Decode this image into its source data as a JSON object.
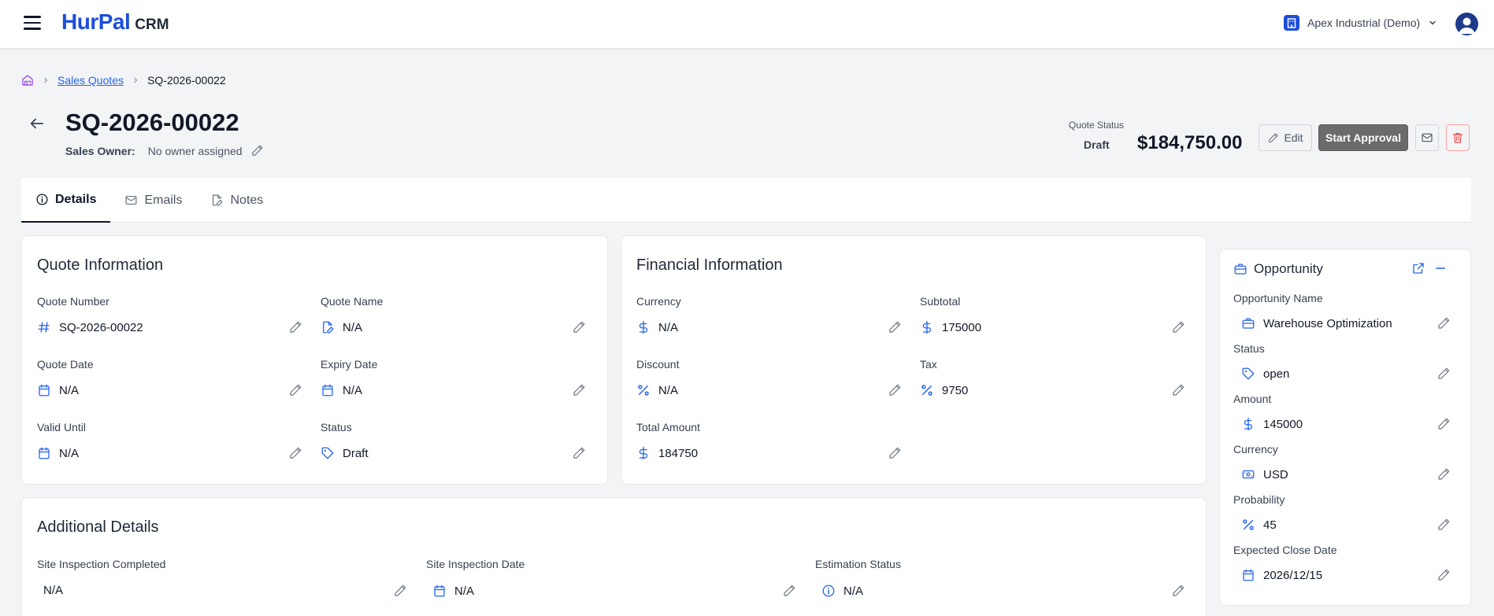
{
  "app": {
    "logo_main": "HurPal",
    "logo_sub": "CRM"
  },
  "org": {
    "name": "Apex Industrial (Demo)"
  },
  "breadcrumb": {
    "parent": "Sales Quotes",
    "current": "SQ-2026-00022"
  },
  "header": {
    "title": "SQ-2026-00022",
    "owner_label": "Sales Owner:",
    "owner_value": "No owner assigned",
    "status_label": "Quote Status",
    "status_value": "Draft",
    "amount": "$184,750.00",
    "edit_label": "Edit",
    "approve_label": "Start Approval"
  },
  "tabs": [
    {
      "label": "Details"
    },
    {
      "label": "Emails"
    },
    {
      "label": "Notes"
    }
  ],
  "quote_info": {
    "title": "Quote Information",
    "fields": [
      {
        "label": "Quote Number",
        "value": "SQ-2026-00022",
        "icon": "hash-icon"
      },
      {
        "label": "Quote Name",
        "value": "N/A",
        "icon": "file-edit-icon"
      },
      {
        "label": "Quote Date",
        "value": "N/A",
        "icon": "calendar-icon"
      },
      {
        "label": "Expiry Date",
        "value": "N/A",
        "icon": "calendar-icon"
      },
      {
        "label": "Valid Until",
        "value": "N/A",
        "icon": "calendar-icon"
      },
      {
        "label": "Status",
        "value": "Draft",
        "icon": "tag-icon"
      }
    ]
  },
  "financial_info": {
    "title": "Financial Information",
    "fields": [
      {
        "label": "Currency",
        "value": "N/A",
        "icon": "dollar-icon"
      },
      {
        "label": "Subtotal",
        "value": "175000",
        "icon": "dollar-icon"
      },
      {
        "label": "Discount",
        "value": "N/A",
        "icon": "percent-icon"
      },
      {
        "label": "Tax",
        "value": "9750",
        "icon": "percent-icon"
      },
      {
        "label": "Total Amount",
        "value": "184750",
        "icon": "dollar-icon"
      }
    ]
  },
  "additional": {
    "title": "Additional Details",
    "fields": [
      {
        "label": "Site Inspection Completed",
        "value": "N/A"
      },
      {
        "label": "Site Inspection Date",
        "value": "N/A",
        "icon": "calendar-icon"
      },
      {
        "label": "Estimation Status",
        "value": "N/A",
        "icon": "info-icon"
      }
    ]
  },
  "opportunity": {
    "title": "Opportunity",
    "fields": [
      {
        "label": "Opportunity Name",
        "value": "Warehouse Optimization",
        "icon": "briefcase-icon"
      },
      {
        "label": "Status",
        "value": "open",
        "icon": "tag-icon"
      },
      {
        "label": "Amount",
        "value": "145000",
        "icon": "dollar-icon"
      },
      {
        "label": "Currency",
        "value": "USD",
        "icon": "banknote-icon"
      },
      {
        "label": "Probability",
        "value": "45",
        "icon": "percent-icon"
      },
      {
        "label": "Expected Close Date",
        "value": "2026/12/15",
        "icon": "calendar-icon"
      }
    ]
  },
  "colors": {
    "accent": "#2563eb",
    "brand": "#1d4ed8",
    "approve_bg": "#6b6b6b",
    "danger": "#ef4444"
  }
}
